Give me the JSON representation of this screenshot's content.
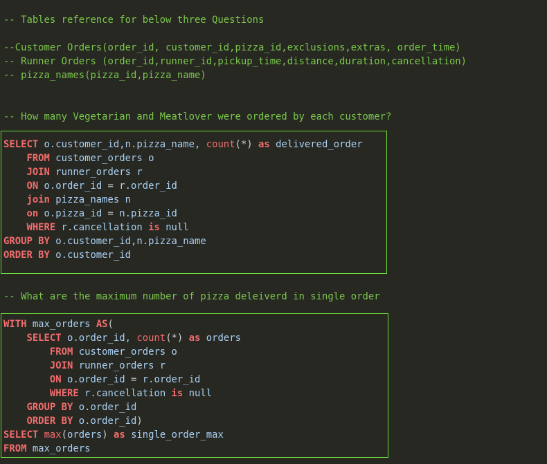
{
  "header_comments": [
    "-- Tables reference for below three Questions",
    "--Customer Orders(order_id, customer_id,pizza_id,exclusions,extras, order_time)",
    "-- Runner Orders (order_id,runner_id,pickup_time,distance,duration,cancellation)",
    "-- pizza_names(pizza_id,pizza_name)"
  ],
  "question1": {
    "comment": "-- How many Vegetarian and Meatlover were ordered by each customer?",
    "lines": [
      [
        [
          "kw",
          "SELECT"
        ],
        [
          "id",
          " o.customer_id,n.pizza_name, "
        ],
        [
          "fn",
          "count"
        ],
        [
          "op",
          "(*)"
        ],
        [
          "id",
          " "
        ],
        [
          "kw",
          "as"
        ],
        [
          "id",
          " delivered_order"
        ]
      ],
      [
        [
          "id",
          "    "
        ],
        [
          "kw",
          "FROM"
        ],
        [
          "id",
          " customer_orders o"
        ]
      ],
      [
        [
          "id",
          "    "
        ],
        [
          "kw",
          "JOIN"
        ],
        [
          "id",
          " runner_orders r"
        ]
      ],
      [
        [
          "id",
          "    "
        ],
        [
          "kw",
          "ON"
        ],
        [
          "id",
          " o.order_id "
        ],
        [
          "op",
          "="
        ],
        [
          "id",
          " r.order_id"
        ]
      ],
      [
        [
          "id",
          "    "
        ],
        [
          "kw",
          "join"
        ],
        [
          "id",
          " pizza_names n"
        ]
      ],
      [
        [
          "id",
          "    "
        ],
        [
          "kw",
          "on"
        ],
        [
          "id",
          " o.pizza_id "
        ],
        [
          "op",
          "="
        ],
        [
          "id",
          " n.pizza_id"
        ]
      ],
      [
        [
          "id",
          "    "
        ],
        [
          "kw",
          "WHERE"
        ],
        [
          "id",
          " r.cancellation "
        ],
        [
          "kw",
          "is"
        ],
        [
          "id",
          " null"
        ]
      ],
      [
        [
          "kw",
          "GROUP BY"
        ],
        [
          "id",
          " o.customer_id,n.pizza_name"
        ]
      ],
      [
        [
          "kw",
          "ORDER BY"
        ],
        [
          "id",
          " o.customer_id"
        ]
      ]
    ]
  },
  "question2": {
    "comment": "-- What are the maximum number of pizza deleiverd in single order",
    "lines": [
      [
        [
          "kw",
          "WITH"
        ],
        [
          "id",
          " max_orders "
        ],
        [
          "kw",
          "AS"
        ],
        [
          "op",
          "("
        ]
      ],
      [
        [
          "id",
          "    "
        ],
        [
          "kw",
          "SELECT"
        ],
        [
          "id",
          " o.order_id, "
        ],
        [
          "fn",
          "count"
        ],
        [
          "op",
          "(*)"
        ],
        [
          "id",
          " "
        ],
        [
          "kw",
          "as"
        ],
        [
          "id",
          " orders"
        ]
      ],
      [
        [
          "id",
          "        "
        ],
        [
          "kw",
          "FROM"
        ],
        [
          "id",
          " customer_orders o"
        ]
      ],
      [
        [
          "id",
          "        "
        ],
        [
          "kw",
          "JOIN"
        ],
        [
          "id",
          " runner_orders r"
        ]
      ],
      [
        [
          "id",
          "        "
        ],
        [
          "kw",
          "ON"
        ],
        [
          "id",
          " o.order_id "
        ],
        [
          "op",
          "="
        ],
        [
          "id",
          " r.order_id"
        ]
      ],
      [
        [
          "id",
          "        "
        ],
        [
          "kw",
          "WHERE"
        ],
        [
          "id",
          " r.cancellation "
        ],
        [
          "kw",
          "is"
        ],
        [
          "id",
          " null"
        ]
      ],
      [
        [
          "id",
          "    "
        ],
        [
          "kw",
          "GROUP BY"
        ],
        [
          "id",
          " o.order_id"
        ]
      ],
      [
        [
          "id",
          "    "
        ],
        [
          "kw",
          "ORDER BY"
        ],
        [
          "id",
          " o.order_id"
        ],
        [
          "op",
          ")"
        ]
      ],
      [
        [
          "kw",
          "SELECT"
        ],
        [
          "id",
          " "
        ],
        [
          "fn",
          "max"
        ],
        [
          "op",
          "("
        ],
        [
          "id",
          "orders"
        ],
        [
          "op",
          ")"
        ],
        [
          "id",
          " "
        ],
        [
          "kw",
          "as"
        ],
        [
          "id",
          " single_order_max"
        ]
      ],
      [
        [
          "kw",
          "FROM"
        ],
        [
          "id",
          " max_orders"
        ]
      ]
    ]
  },
  "colors": {
    "background": "#272822",
    "comment": "#7bc74d",
    "keyword": "#f26d6d",
    "identifier": "#aad0f3",
    "box_border": "#6fdc3a"
  }
}
